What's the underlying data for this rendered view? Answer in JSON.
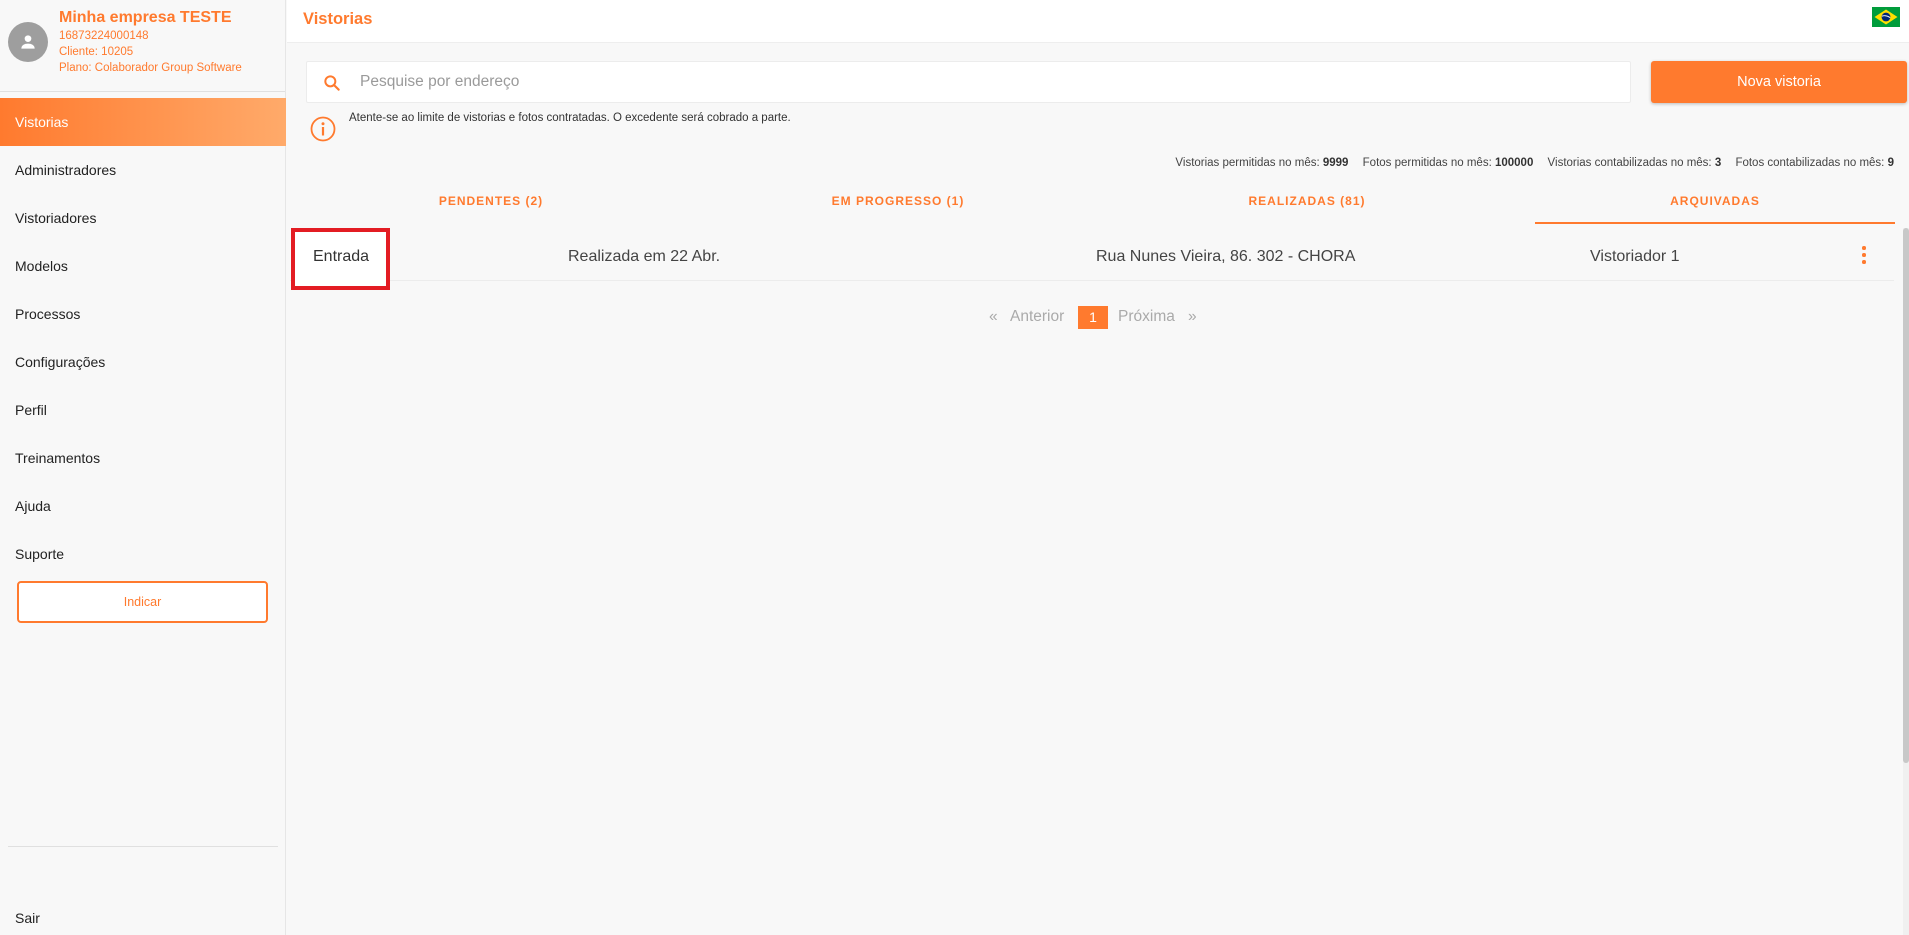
{
  "profile": {
    "company_name": "Minha empresa TESTE",
    "document_id": "16873224000148",
    "client": "Cliente: 10205",
    "plan": "Plano: Colaborador Group Software"
  },
  "sidebar": {
    "items": [
      {
        "label": "Vistorias",
        "active": true
      },
      {
        "label": "Administradores"
      },
      {
        "label": "Vistoriadores"
      },
      {
        "label": "Modelos"
      },
      {
        "label": "Processos"
      },
      {
        "label": "Configurações"
      },
      {
        "label": "Perfil"
      },
      {
        "label": "Treinamentos"
      },
      {
        "label": "Ajuda"
      },
      {
        "label": "Suporte"
      }
    ],
    "indicar_label": "Indicar",
    "logout_label": "Sair"
  },
  "header": {
    "title": "Vistorias",
    "language_flag": "brazil-flag-icon"
  },
  "search": {
    "placeholder": "Pesquise por endereço",
    "value": ""
  },
  "actions": {
    "new_label": "Nova vistoria"
  },
  "notice": {
    "text": "Atente-se ao limite de vistorias e fotos contratadas. O excedente será cobrado a parte."
  },
  "stats": [
    {
      "label": "Vistorias permitidas no mês:",
      "value": "9999"
    },
    {
      "label": "Fotos permitidas no mês:",
      "value": "100000"
    },
    {
      "label": "Vistorias contabilizadas no mês:",
      "value": "3"
    },
    {
      "label": "Fotos contabilizadas no mês:",
      "value": "9"
    }
  ],
  "tabs": [
    {
      "label": "PENDENTES (2)"
    },
    {
      "label": "EM PROGRESSO (1)"
    },
    {
      "label": "REALIZADAS (81)"
    },
    {
      "label": "ARQUIVADAS",
      "active": true
    }
  ],
  "inspections": [
    {
      "type": "Entrada",
      "status": "Realizada em 22 Abr.",
      "address": "Rua Nunes Vieira, 86. 302 - CHORA",
      "inspector": "Vistoriador 1"
    }
  ],
  "pagination": {
    "prev_symbol": "«",
    "prev_label": "Anterior",
    "current_page": "1",
    "next_label": "Próxima",
    "next_symbol": "»"
  },
  "colors": {
    "accent": "#ff7a2e",
    "highlight_border": "#e31c23"
  }
}
